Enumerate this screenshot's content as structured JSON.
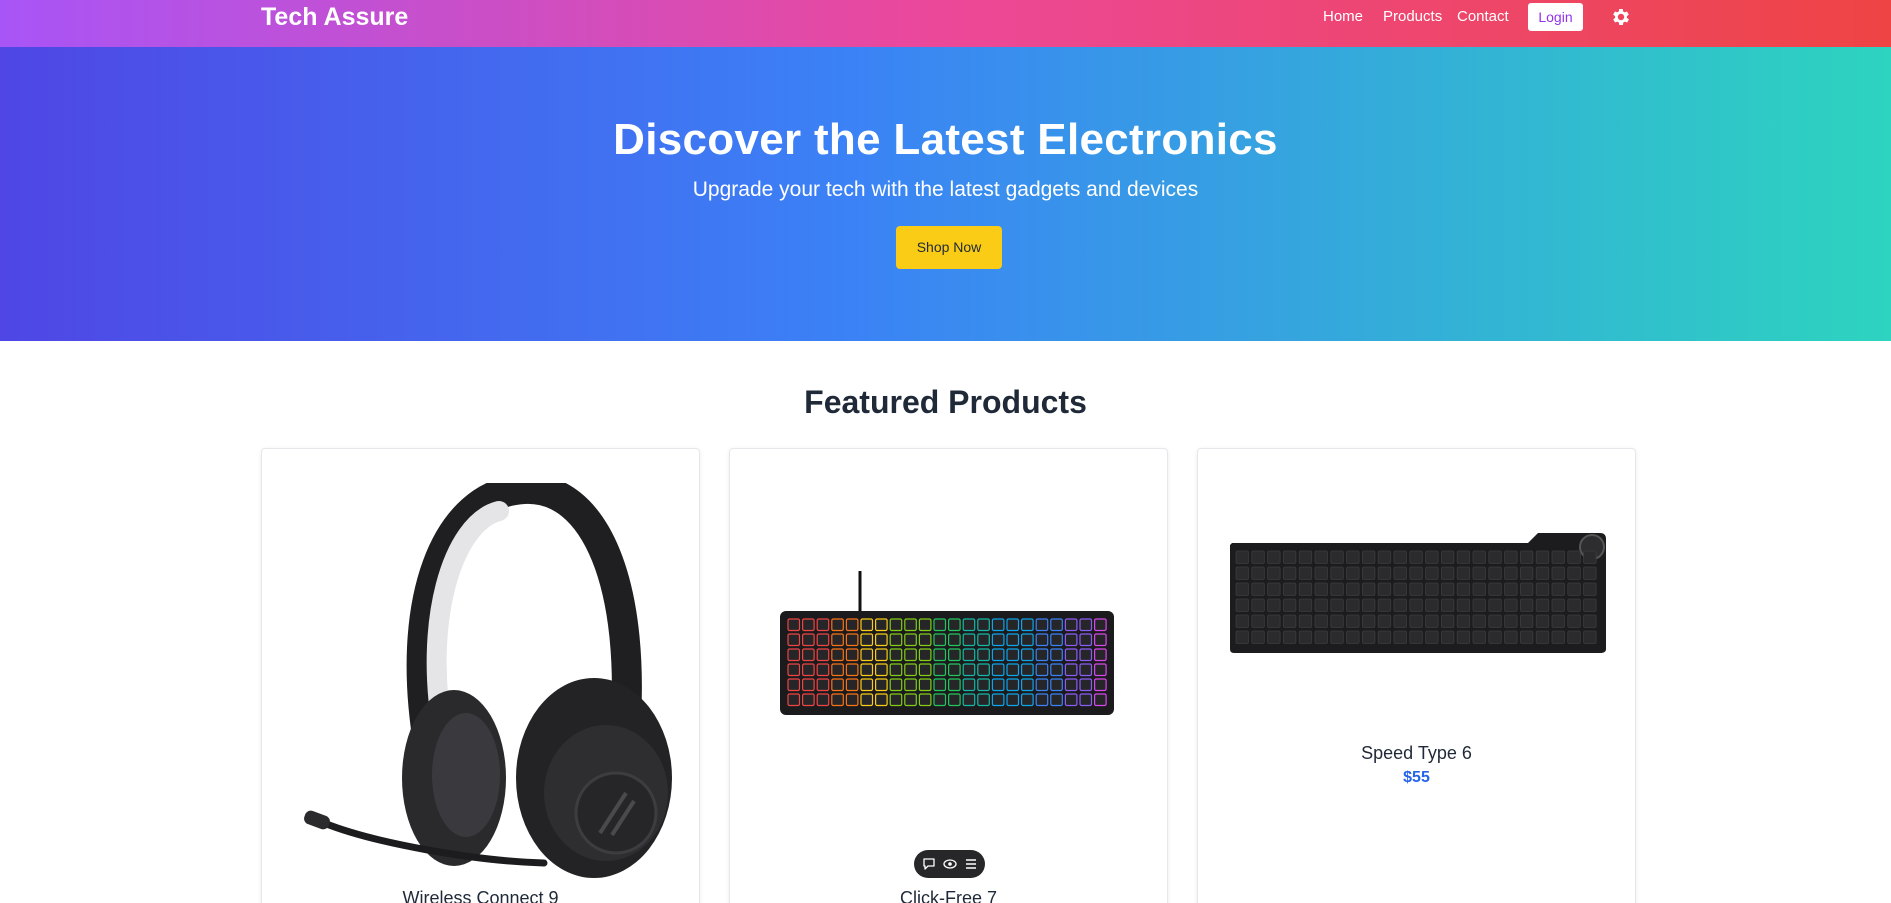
{
  "header": {
    "brand": "Tech Assure",
    "nav": [
      "Home",
      "Products",
      "Contact"
    ],
    "login_label": "Login",
    "settings_icon": "gear-icon"
  },
  "hero": {
    "title": "Discover the Latest Electronics",
    "subtitle": "Upgrade your tech with the latest gadgets and devices",
    "cta_label": "Shop Now"
  },
  "featured": {
    "title": "Featured Products",
    "products": [
      {
        "name": "Wireless Connect 9",
        "image": "headphones-image"
      },
      {
        "name": "Click-Free 7",
        "image": "rgb-keyboard-image"
      },
      {
        "name": "Speed Type 6",
        "price": "$55",
        "image": "black-keyboard-image"
      }
    ]
  },
  "toolbar": {
    "icons": [
      "comment-icon",
      "eye-icon",
      "menu-icon"
    ]
  },
  "colors": {
    "header_gradient": [
      "#a855f7",
      "#ec4899",
      "#ef4444"
    ],
    "hero_gradient": [
      "#4f46e5",
      "#3b82f6",
      "#2dd4bf"
    ],
    "cta": "#facc15",
    "price": "#2563eb"
  }
}
